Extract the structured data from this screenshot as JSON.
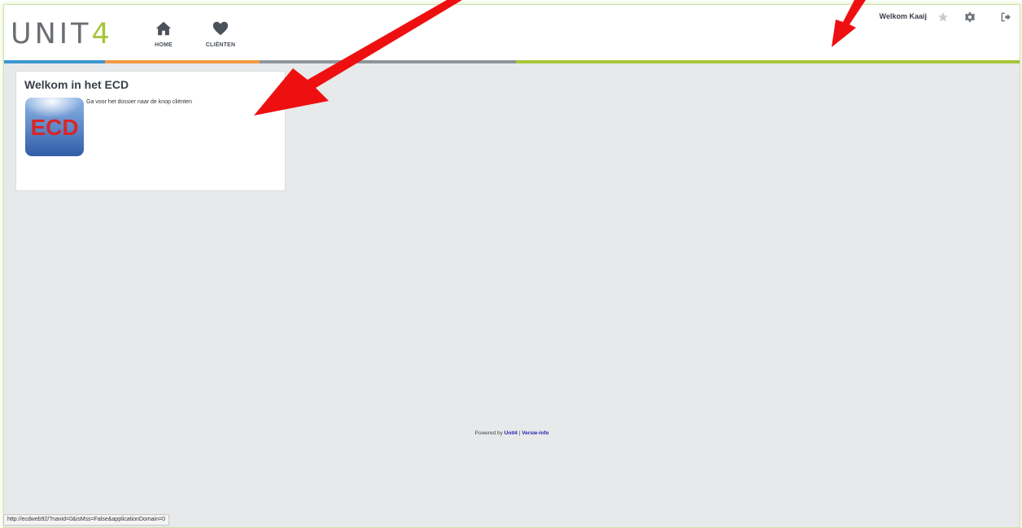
{
  "header": {
    "logo_main": "UNIT",
    "logo_accent": "4",
    "nav": [
      {
        "label": "HOME",
        "icon": "home-icon"
      },
      {
        "label": "CLIËNTEN",
        "icon": "heart-icon"
      }
    ],
    "welcome_text": "Welkom Kaaij",
    "icons": [
      "star-icon",
      "gear-icon",
      "logout-icon"
    ]
  },
  "card": {
    "title": "Welkom in het ECD",
    "logo_text": "ECD",
    "text": "Ga voor het dossier naar de knop cliënten"
  },
  "footer": {
    "prefix": "Powered by ",
    "brand_link": "Unit4",
    "separator": " | ",
    "version_link": "Versie-info"
  },
  "status_url": "http://ecdweb92/?navid=0&isMss=False&applicationDomain=0",
  "colors": {
    "stripe_blue": "#3d96cf",
    "stripe_orange": "#f29a45",
    "stripe_gray": "#8e959b",
    "stripe_green": "#a7c53a",
    "annotation_red": "#ee1010"
  }
}
